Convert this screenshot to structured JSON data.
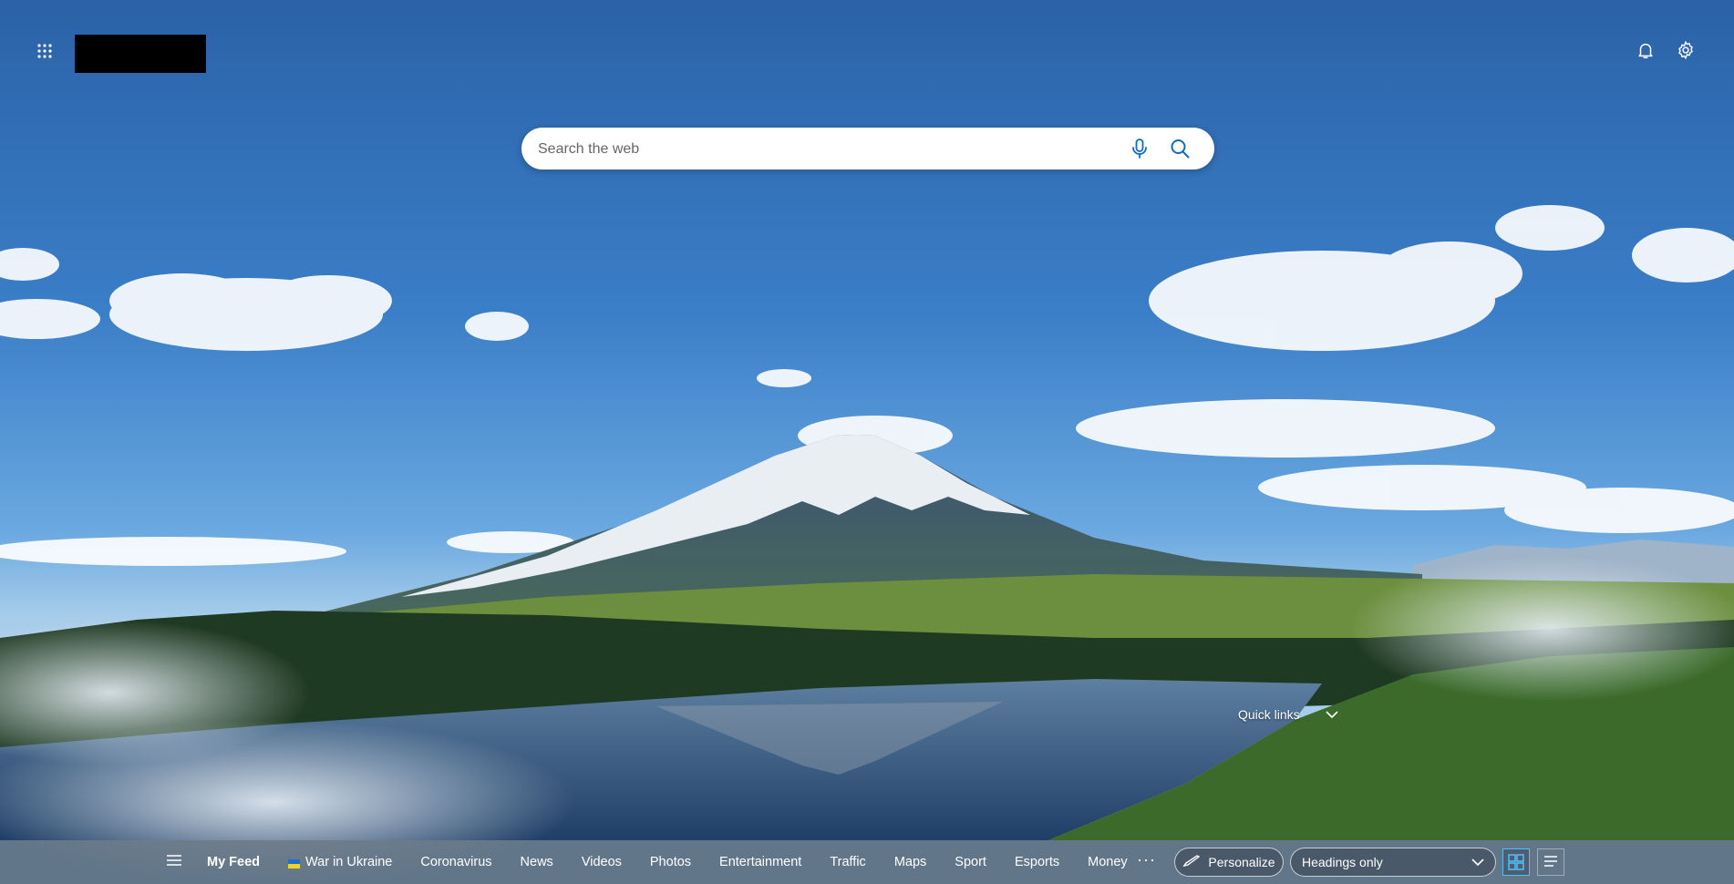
{
  "header": {
    "apps_icon": "apps-grid-icon",
    "notifications_icon": "bell-icon",
    "settings_icon": "gear-icon"
  },
  "search": {
    "placeholder": "Search the web",
    "mic_icon": "microphone-icon",
    "search_icon": "search-icon"
  },
  "quick_links": {
    "label": "Quick links",
    "icon": "chevron-down-icon"
  },
  "nav": {
    "menu_icon": "hamburger-icon",
    "items": [
      {
        "label": "My Feed",
        "active": true
      },
      {
        "label": "War in Ukraine",
        "flag": "ukraine-flag-icon"
      },
      {
        "label": "Coronavirus"
      },
      {
        "label": "News"
      },
      {
        "label": "Videos"
      },
      {
        "label": "Photos"
      },
      {
        "label": "Entertainment"
      },
      {
        "label": "Traffic"
      },
      {
        "label": "Maps"
      },
      {
        "label": "Sport"
      },
      {
        "label": "Esports"
      },
      {
        "label": "Money"
      }
    ],
    "more_label": "···",
    "personalize_label": "Personalize",
    "layout_select": {
      "value": "Headings only"
    },
    "grid_view_icon": "grid-view-icon",
    "list_view_icon": "list-view-icon"
  },
  "colors": {
    "sky_top": "#2c63a8",
    "sky_mid": "#3f86cf",
    "accent": "#4cc2ff",
    "search_icon": "#0f6cbd"
  }
}
